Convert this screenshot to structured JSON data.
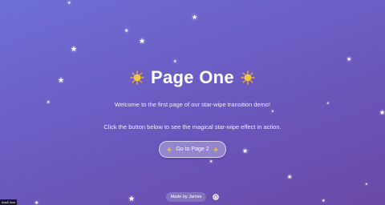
{
  "page": {
    "title": "Page One",
    "intro": "Welcome to the first page of our star-wipe transition demo!",
    "instruction": "Click the button below to see the magical star-wipe effect in action."
  },
  "button": {
    "label": "Go to Page 2"
  },
  "footer": {
    "author": "Made by James"
  },
  "corner": {
    "label": "Aus2 Ann"
  },
  "icons": {
    "title_left": "sun-icon",
    "title_right": "sun-icon",
    "button_left": "sparkle-icon",
    "button_right": "sparkle-icon",
    "footer": "github-icon",
    "background": "star-icon"
  },
  "colors": {
    "background_start": "#6f6fd6",
    "background_end": "#6a4aa6",
    "text": "#ffffff",
    "sun": "#f5c542"
  }
}
